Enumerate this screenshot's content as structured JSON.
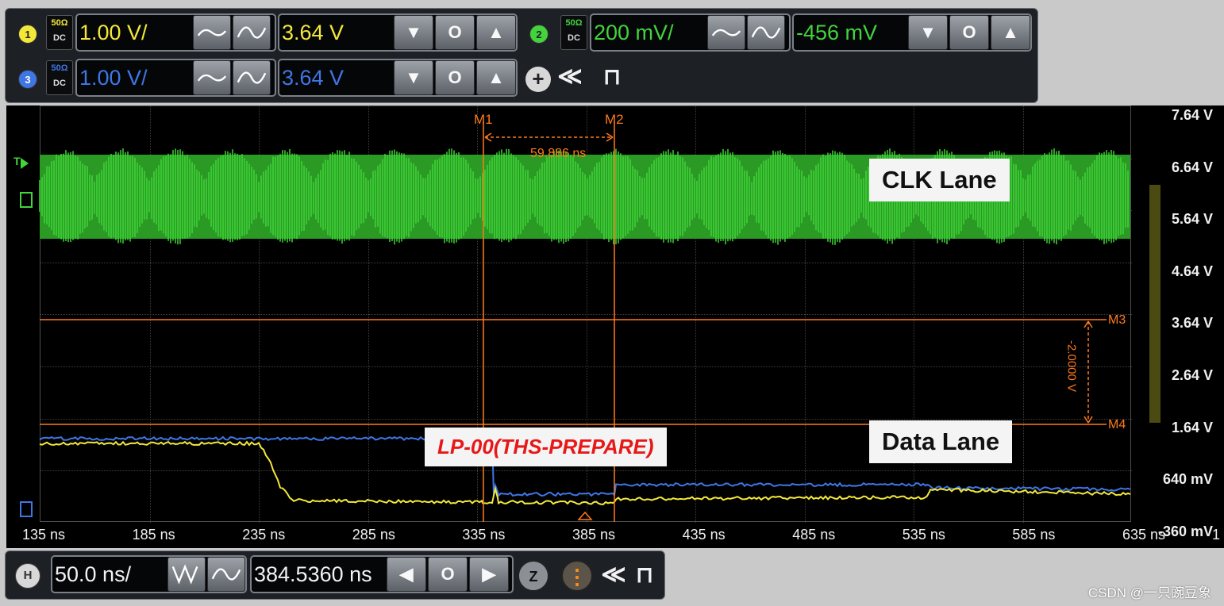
{
  "channels": {
    "ch1": {
      "num": "1",
      "imp": "50Ω",
      "coupling": "DC",
      "scale": "1.00 V/",
      "offset": "3.64 V",
      "color": "#f3e83a"
    },
    "ch2": {
      "num": "2",
      "imp": "50Ω",
      "coupling": "DC",
      "scale": "200 mV/",
      "offset": "-456 mV",
      "color": "#43d33d"
    },
    "ch3": {
      "num": "3",
      "imp": "50Ω",
      "coupling": "DC",
      "scale": "1.00 V/",
      "offset": "3.64 V",
      "color": "#3f76e6"
    }
  },
  "icons": {
    "up": "▲",
    "down": "▼",
    "zero": "O",
    "left": "◀",
    "right": "▶",
    "plus": "+",
    "collapse": "≪",
    "pin": "⊓",
    "z": "Z",
    "dots": "⋮"
  },
  "horizontal": {
    "label": "H",
    "scale": "50.0 ns/",
    "position": "384.5360 ns"
  },
  "markers": {
    "m1": "M1",
    "m2": "M2",
    "m3": "M3",
    "m4": "M4",
    "delta_t": "59.886 ns",
    "delta_v": "-2.0000 V"
  },
  "trigger_label": "T",
  "right_axis": [
    "7.64 V",
    "6.64 V",
    "5.64 V",
    "4.64 V",
    "3.64 V",
    "2.64 V",
    "1.64 V",
    "640 mV",
    "-360 mV"
  ],
  "time_axis": [
    "135 ns",
    "185 ns",
    "235 ns",
    "285 ns",
    "335 ns",
    "385 ns",
    "435 ns",
    "485 ns",
    "535 ns",
    "585 ns",
    "635 ns"
  ],
  "time_axis_extra": "1",
  "annotations": {
    "clk": "CLK Lane",
    "data": "Data Lane",
    "lp": "LP-00(THS-PREPARE)"
  },
  "watermark": "CSDN @一只豌豆象",
  "colors": {
    "marker": "#ff7a1a",
    "clk_wave": "#2fb82a",
    "ch1": "#f3e83a",
    "ch3": "#3f76e6",
    "lp_text": "#e81818"
  }
}
